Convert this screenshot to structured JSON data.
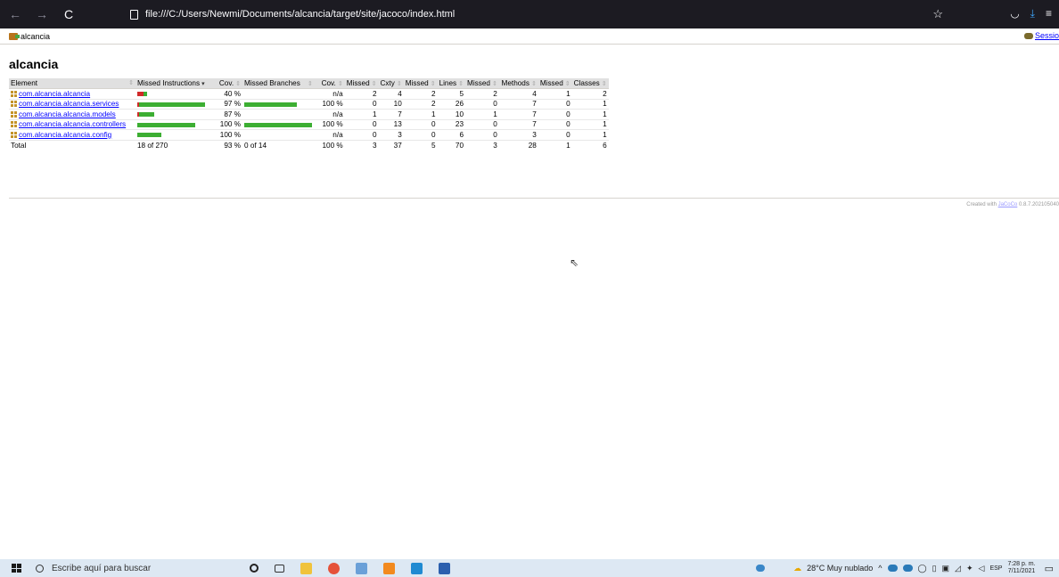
{
  "browser": {
    "url": "file:///C:/Users/Newmi/Documents/alcancia/target/site/jacoco/index.html"
  },
  "breadcrumb": {
    "label": "alcancia",
    "sessions_label": "Sessio"
  },
  "page_title": "alcancia",
  "table": {
    "headers": [
      "Element",
      "Missed Instructions",
      "Cov.",
      "Missed Branches",
      "Cov.",
      "Missed",
      "Cxty",
      "Missed",
      "Lines",
      "Missed",
      "Methods",
      "Missed",
      "Classes"
    ],
    "rows": [
      {
        "name": "com.alcancia.alcancia",
        "instr_cov_fraction": 0.4,
        "instr_bar_fill": 0.15,
        "instr_cov": "40 %",
        "branch_bar_fill": 0,
        "branch_cov": "n/a",
        "cxty_missed": "2",
        "cxty": "4",
        "lines_missed": "2",
        "lines": "5",
        "methods_missed": "2",
        "methods": "4",
        "classes_missed": "1",
        "classes": "2"
      },
      {
        "name": "com.alcancia.alcancia.services",
        "instr_cov_fraction": 0.97,
        "instr_bar_fill": 1.0,
        "instr_cov": "97 %",
        "branch_bar_fill": 0.78,
        "branch_cov": "100 %",
        "cxty_missed": "0",
        "cxty": "10",
        "lines_missed": "2",
        "lines": "26",
        "methods_missed": "0",
        "methods": "7",
        "classes_missed": "0",
        "classes": "1"
      },
      {
        "name": "com.alcancia.alcancia.models",
        "instr_cov_fraction": 0.87,
        "instr_bar_fill": 0.25,
        "instr_cov": "87 %",
        "branch_bar_fill": 0,
        "branch_cov": "n/a",
        "cxty_missed": "1",
        "cxty": "7",
        "lines_missed": "1",
        "lines": "10",
        "methods_missed": "1",
        "methods": "7",
        "classes_missed": "0",
        "classes": "1"
      },
      {
        "name": "com.alcancia.alcancia.controllers",
        "instr_cov_fraction": 1.0,
        "instr_bar_fill": 0.86,
        "instr_cov": "100 %",
        "branch_bar_fill": 1.0,
        "branch_cov": "100 %",
        "cxty_missed": "0",
        "cxty": "13",
        "lines_missed": "0",
        "lines": "23",
        "methods_missed": "0",
        "methods": "7",
        "classes_missed": "0",
        "classes": "1"
      },
      {
        "name": "com.alcancia.alcancia.config",
        "instr_cov_fraction": 1.0,
        "instr_bar_fill": 0.36,
        "instr_cov": "100 %",
        "branch_bar_fill": 0,
        "branch_cov": "n/a",
        "cxty_missed": "0",
        "cxty": "3",
        "lines_missed": "0",
        "lines": "6",
        "methods_missed": "0",
        "methods": "3",
        "classes_missed": "0",
        "classes": "1"
      }
    ],
    "total": {
      "label": "Total",
      "instr": "18 of 270",
      "instr_cov": "93 %",
      "branch": "0 of 14",
      "branch_cov": "100 %",
      "cxty_missed": "3",
      "cxty": "37",
      "lines_missed": "5",
      "lines": "70",
      "methods_missed": "3",
      "methods": "28",
      "classes_missed": "1",
      "classes": "6"
    }
  },
  "footer": {
    "prefix": "Created with ",
    "link": "JaCoCo",
    "suffix": " 0.8.7.202105040"
  },
  "taskbar": {
    "search_placeholder": "Escribe aquí para buscar",
    "weather": "28°C  Muy nublado",
    "lang": "ESP",
    "time": "7:28 p. m.",
    "date": "7/11/2021"
  },
  "colors": {
    "missed": "#d12a2a",
    "covered": "#3cae32"
  }
}
